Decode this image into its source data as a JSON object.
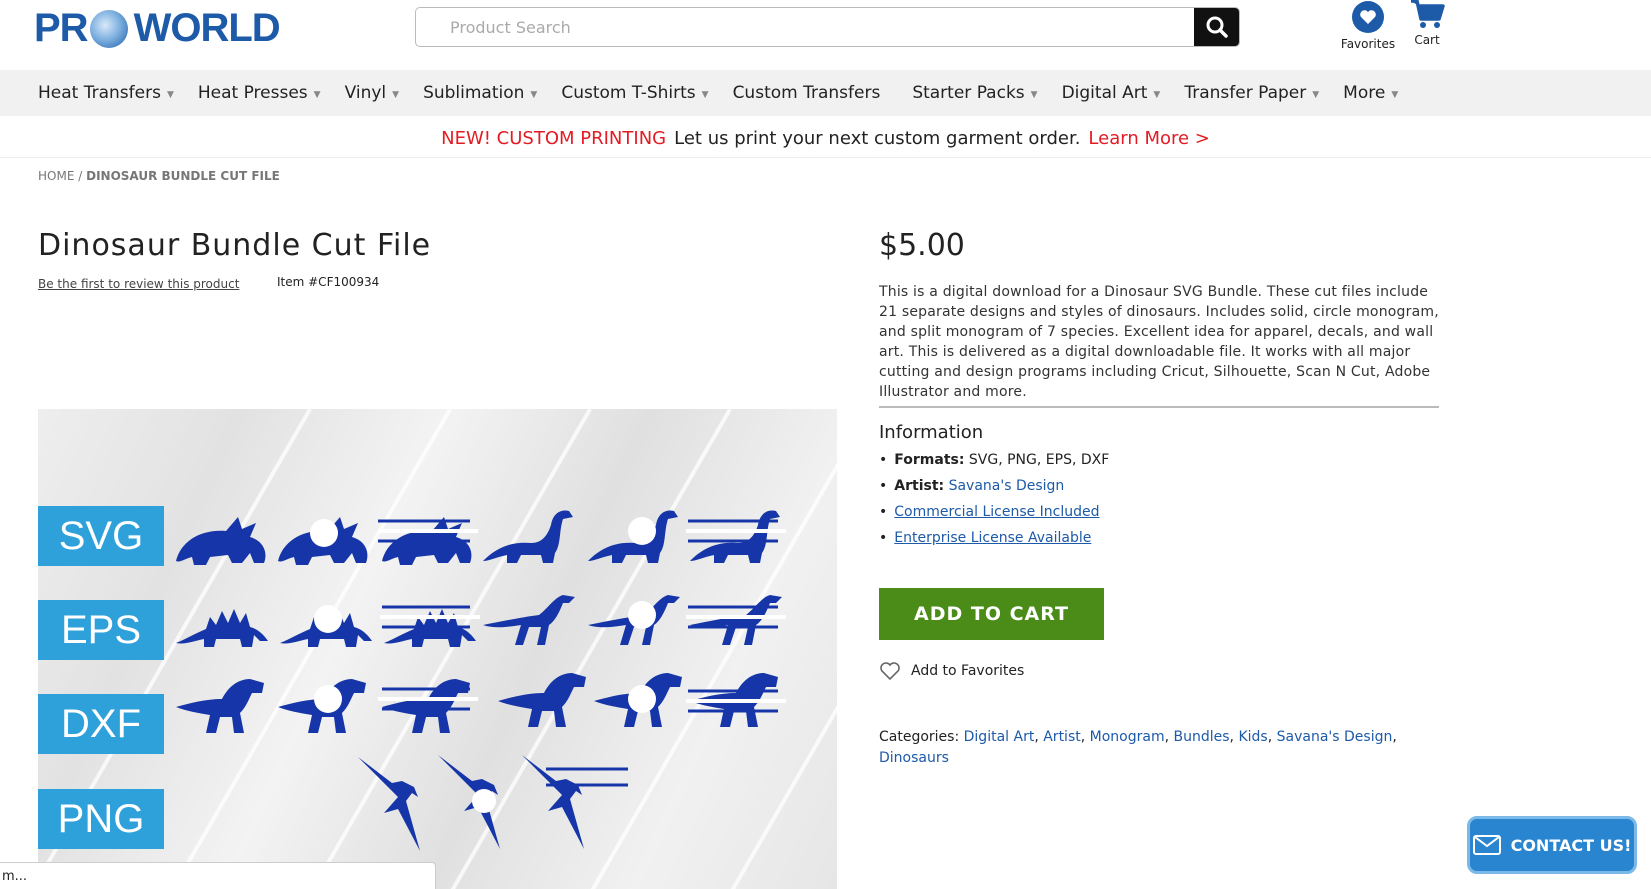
{
  "brand": {
    "logo_left": "PR",
    "logo_right": "WORLD"
  },
  "search": {
    "placeholder": "Product Search"
  },
  "header": {
    "favorites_label": "Favorites",
    "cart_label": "Cart"
  },
  "nav": {
    "items": [
      {
        "label": "Heat Transfers",
        "caret": true
      },
      {
        "label": "Heat Presses",
        "caret": true
      },
      {
        "label": "Vinyl",
        "caret": true
      },
      {
        "label": "Sublimation",
        "caret": true
      },
      {
        "label": "Custom T-Shirts",
        "caret": true
      },
      {
        "label": "Custom Transfers",
        "caret": false
      },
      {
        "label": "Starter Packs",
        "caret": true
      },
      {
        "label": "Digital Art",
        "caret": true
      },
      {
        "label": "Transfer Paper",
        "caret": true
      },
      {
        "label": "More",
        "caret": true
      }
    ]
  },
  "promo": {
    "highlight": "NEW! CUSTOM PRINTING",
    "message": "Let us print your next custom garment order.",
    "link": "Learn More >"
  },
  "breadcrumb": {
    "home": "HOME",
    "separator": "/",
    "current": "DINOSAUR BUNDLE CUT FILE"
  },
  "product": {
    "title": "Dinosaur Bundle Cut File",
    "review_link": "Be the first to review this product",
    "item_number": "Item #CF100934",
    "price": "$5.00",
    "description": "This is a digital download for a Dinosaur SVG Bundle. These cut files include 21 separate designs and styles of dinosaurs. Includes solid, circle monogram, and split monogram of 7 species. Excellent idea for apparel, decals, and wall art. This is delivered as a digital downloadable file. It works with all major cutting and design programs including Cricut, Silhouette, Scan N Cut, Adobe Illustrator and more.",
    "image_formats": [
      "SVG",
      "EPS",
      "DXF",
      "PNG"
    ]
  },
  "information": {
    "heading": "Information",
    "formats_label": "Formats:",
    "formats_value": "SVG, PNG, EPS, DXF",
    "artist_label": "Artist:",
    "artist_value": "Savana's Design",
    "commercial_license": "Commercial License Included",
    "enterprise_license": "Enterprise License Available"
  },
  "actions": {
    "add_to_cart": "ADD TO CART",
    "add_to_favorites": "Add to Favorites"
  },
  "categories": {
    "label": "Categories:",
    "items": [
      "Digital Art",
      "Artist",
      "Monogram",
      "Bundles",
      "Kids",
      "Savana's Design",
      "Dinosaurs"
    ]
  },
  "contact": {
    "label": "CONTACT US!"
  },
  "status_bar": {
    "text": "m..."
  },
  "colors": {
    "brand_blue": "#1d5aa8",
    "promo_red": "#e31b23",
    "cart_green": "#4a8c17",
    "format_blue": "#2ea1db",
    "dino_blue": "#1535a8"
  }
}
